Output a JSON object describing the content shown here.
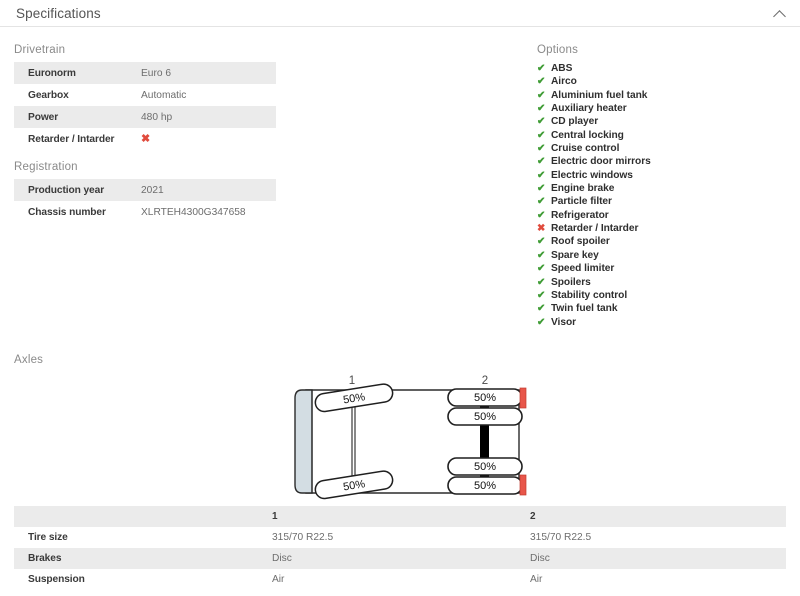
{
  "panel": {
    "title": "Specifications",
    "collapse_icon": "chevron-up-icon"
  },
  "drivetrain": {
    "label": "Drivetrain",
    "rows": [
      {
        "key": "Euronorm",
        "value": "Euro 6",
        "type": "text"
      },
      {
        "key": "Gearbox",
        "value": "Automatic",
        "type": "text"
      },
      {
        "key": "Power",
        "value": "480 hp",
        "type": "text"
      },
      {
        "key": "Retarder / Intarder",
        "value": "✖",
        "type": "no"
      }
    ]
  },
  "registration": {
    "label": "Registration",
    "rows": [
      {
        "key": "Production year",
        "value": "2021",
        "type": "text"
      },
      {
        "key": "Chassis number",
        "value": "XLRTEH4300G347658",
        "type": "text"
      }
    ]
  },
  "options": {
    "label": "Options",
    "check_glyph": "✔",
    "cross_glyph": "✖",
    "items": [
      {
        "label": "ABS",
        "available": true
      },
      {
        "label": "Airco",
        "available": true
      },
      {
        "label": "Aluminium fuel tank",
        "available": true
      },
      {
        "label": "Auxiliary heater",
        "available": true
      },
      {
        "label": "CD player",
        "available": true
      },
      {
        "label": "Central locking",
        "available": true
      },
      {
        "label": "Cruise control",
        "available": true
      },
      {
        "label": "Electric door mirrors",
        "available": true
      },
      {
        "label": "Electric windows",
        "available": true
      },
      {
        "label": "Engine brake",
        "available": true
      },
      {
        "label": "Particle filter",
        "available": true
      },
      {
        "label": "Refrigerator",
        "available": true
      },
      {
        "label": "Retarder / Intarder",
        "available": false
      },
      {
        "label": "Roof spoiler",
        "available": true
      },
      {
        "label": "Spare key",
        "available": true
      },
      {
        "label": "Speed limiter",
        "available": true
      },
      {
        "label": "Spoilers",
        "available": true
      },
      {
        "label": "Stability control",
        "available": true
      },
      {
        "label": "Twin fuel tank",
        "available": true
      },
      {
        "label": "Visor",
        "available": true
      }
    ]
  },
  "axles": {
    "label": "Axles",
    "diagram": {
      "axle_numbers": [
        "1",
        "2"
      ],
      "tread_labels": [
        "50%",
        "50%",
        "50%",
        "50%",
        "50%",
        "50%"
      ],
      "front_axle": {
        "number": "1",
        "wheels": 2,
        "steering": true,
        "tread": [
          "50%",
          "50%"
        ]
      },
      "rear_axle": {
        "number": "2",
        "wheels": 4,
        "steering": false,
        "tread": [
          "50%",
          "50%",
          "50%",
          "50%"
        ]
      },
      "cab_color": "#d3dde3",
      "marker_color": "#e8564a"
    },
    "table": {
      "headers": [
        "",
        "1",
        "2"
      ],
      "rows": [
        {
          "label": "Tire size",
          "values": [
            "315/70 R22.5",
            "315/70 R22.5"
          ]
        },
        {
          "label": "Brakes",
          "values": [
            "Disc",
            "Disc"
          ]
        },
        {
          "label": "Suspension",
          "values": [
            "Air",
            "Air"
          ]
        }
      ]
    }
  }
}
